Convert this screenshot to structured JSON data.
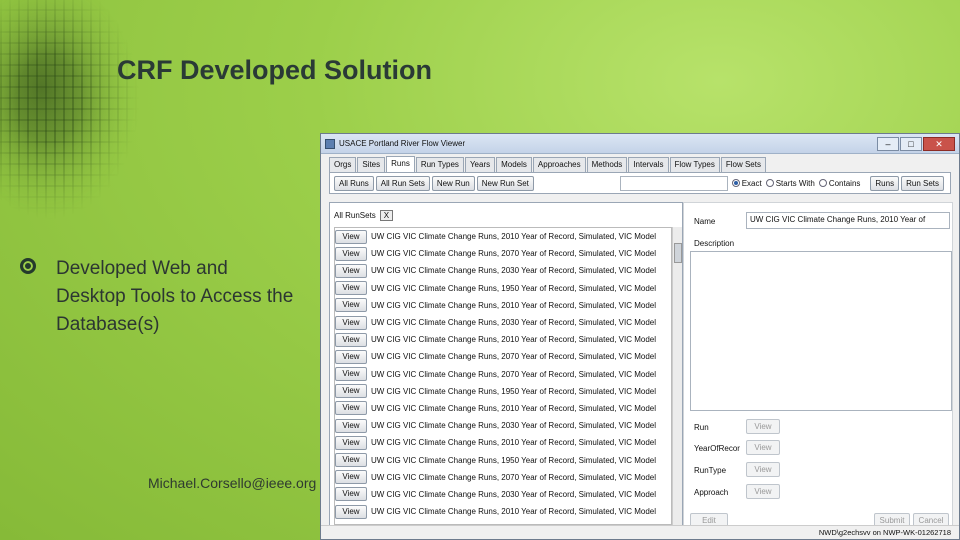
{
  "slide": {
    "title": "CRF Developed Solution",
    "bullet_text": "Developed Web and Desktop Tools to Access the Database(s)",
    "email": "Michael.Corsello@ieee.org"
  },
  "window": {
    "title": "USACE Portland River Flow Viewer",
    "tabs": [
      "Orgs",
      "Sites",
      "Runs",
      "Run Types",
      "Years",
      "Models",
      "Approaches",
      "Methods",
      "Intervals",
      "Flow Types",
      "Flow Sets"
    ],
    "active_tab": "Runs",
    "toolbar": {
      "all_runs": "All Runs",
      "all_run_sets": "All Run Sets",
      "new_run": "New Run",
      "new_run_set": "New Run Set",
      "search_value": "",
      "exact": "Exact",
      "starts_with": "Starts With",
      "contains": "Contains",
      "runs_btn": "Runs",
      "run_sets_btn": "Run Sets"
    },
    "left_panel": {
      "tab_label": "All RunSets",
      "close": "X",
      "view_label": "View",
      "rows": [
        "UW CIG VIC Climate Change Runs, 2010 Year of Record, Simulated, VIC Model",
        "UW CIG VIC Climate Change Runs, 2070 Year of Record, Simulated, VIC Model",
        "UW CIG VIC Climate Change Runs, 2030 Year of Record, Simulated, VIC Model",
        "UW CIG VIC Climate Change Runs, 1950 Year of Record, Simulated, VIC Model",
        "UW CIG VIC Climate Change Runs, 2010 Year of Record, Simulated, VIC Model",
        "UW CIG VIC Climate Change Runs, 2030 Year of Record, Simulated, VIC Model",
        "UW CIG VIC Climate Change Runs, 2010 Year of Record, Simulated, VIC Model",
        "UW CIG VIC Climate Change Runs, 2070 Year of Record, Simulated, VIC Model",
        "UW CIG VIC Climate Change Runs, 2070 Year of Record, Simulated, VIC Model",
        "UW CIG VIC Climate Change Runs, 1950 Year of Record, Simulated, VIC Model",
        "UW CIG VIC Climate Change Runs, 2010 Year of Record, Simulated, VIC Model",
        "UW CIG VIC Climate Change Runs, 2030 Year of Record, Simulated, VIC Model",
        "UW CIG VIC Climate Change Runs, 2010 Year of Record, Simulated, VIC Model",
        "UW CIG VIC Climate Change Runs, 1950 Year of Record, Simulated, VIC Model",
        "UW CIG VIC Climate Change Runs, 2070 Year of Record, Simulated, VIC Model",
        "UW CIG VIC Climate Change Runs, 2030 Year of Record, Simulated, VIC Model",
        "UW CIG VIC Climate Change Runs, 2010 Year of Record, Simulated, VIC Model"
      ]
    },
    "right_panel": {
      "name_label": "Name",
      "name_value": "UW CIG VIC Climate Change Runs, 2010 Year of",
      "description_label": "Description",
      "run_label": "Run",
      "year_label": "YearOfRecor",
      "runtype_label": "RunType",
      "approach_label": "Approach",
      "view_label": "View",
      "edit": "Edit",
      "submit": "Submit",
      "cancel": "Cancel"
    },
    "status": "NWD\\g2echsvv on NWP-WK-01262718"
  }
}
